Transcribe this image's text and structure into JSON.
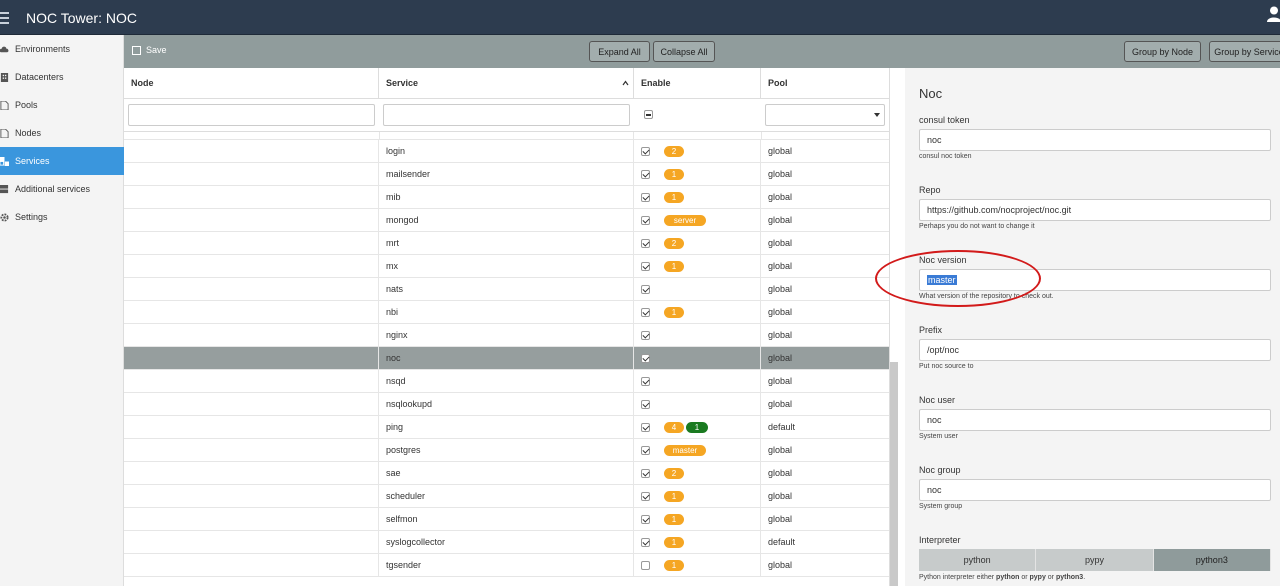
{
  "app": {
    "title": "NOC Tower: NOC"
  },
  "sidebar": {
    "items": [
      {
        "label": "Environments",
        "icon": "cloud-icon"
      },
      {
        "label": "Datacenters",
        "icon": "building-icon"
      },
      {
        "label": "Pools",
        "icon": "document-icon"
      },
      {
        "label": "Nodes",
        "icon": "document-icon"
      },
      {
        "label": "Services",
        "icon": "cubes-icon",
        "active": true
      },
      {
        "label": "Additional services",
        "icon": "server-icon"
      },
      {
        "label": "Settings",
        "icon": "gear-icon"
      }
    ]
  },
  "toolbar": {
    "save": "Save",
    "expand_all": "Expand All",
    "collapse_all": "Collapse All",
    "group_by_node": "Group by Node",
    "group_by_service": "Group by Service"
  },
  "grid": {
    "headers": {
      "node": "Node",
      "service": "Service",
      "enable": "Enable",
      "pool": "Pool"
    },
    "rows": [
      {
        "service": "login",
        "enabled": true,
        "badges": [
          "2"
        ],
        "pool": "global"
      },
      {
        "service": "mailsender",
        "enabled": true,
        "badges": [
          "1"
        ],
        "pool": "global"
      },
      {
        "service": "mib",
        "enabled": true,
        "badges": [
          "1"
        ],
        "pool": "global"
      },
      {
        "service": "mongod",
        "enabled": true,
        "badges": [
          "server"
        ],
        "pool": "global"
      },
      {
        "service": "mrt",
        "enabled": true,
        "badges": [
          "2"
        ],
        "pool": "global"
      },
      {
        "service": "mx",
        "enabled": true,
        "badges": [
          "1"
        ],
        "pool": "global"
      },
      {
        "service": "nats",
        "enabled": true,
        "badges": [],
        "pool": "global"
      },
      {
        "service": "nbi",
        "enabled": true,
        "badges": [
          "1"
        ],
        "pool": "global"
      },
      {
        "service": "nginx",
        "enabled": true,
        "badges": [],
        "pool": "global"
      },
      {
        "service": "noc",
        "enabled": true,
        "badges": [],
        "pool": "global",
        "selected": true
      },
      {
        "service": "nsqd",
        "enabled": true,
        "badges": [],
        "pool": "global"
      },
      {
        "service": "nsqlookupd",
        "enabled": true,
        "badges": [],
        "pool": "global"
      },
      {
        "service": "ping",
        "enabled": true,
        "badges": [
          "4"
        ],
        "green_badge": "1",
        "pool": "default"
      },
      {
        "service": "postgres",
        "enabled": true,
        "badges": [
          "master"
        ],
        "pool": "global"
      },
      {
        "service": "sae",
        "enabled": true,
        "badges": [
          "2"
        ],
        "pool": "global"
      },
      {
        "service": "scheduler",
        "enabled": true,
        "badges": [
          "1"
        ],
        "pool": "global"
      },
      {
        "service": "selfmon",
        "enabled": true,
        "badges": [
          "1"
        ],
        "pool": "global"
      },
      {
        "service": "syslogcollector",
        "enabled": true,
        "badges": [
          "1"
        ],
        "pool": "default"
      },
      {
        "service": "tgsender",
        "enabled": false,
        "badges": [
          "1"
        ],
        "pool": "global"
      }
    ]
  },
  "panel": {
    "title": "Noc",
    "fields": [
      {
        "label": "consul token",
        "value": "noc",
        "help": "consul noc token"
      },
      {
        "label": "Repo",
        "value": "https://github.com/nocproject/noc.git",
        "help": "Perhaps you do not want to change it"
      },
      {
        "label": "Noc version",
        "value": "master",
        "help": "What version of the repository to check out."
      },
      {
        "label": "Prefix",
        "value": "/opt/noc",
        "help": "Put noc source to"
      },
      {
        "label": "Noc user",
        "value": "noc",
        "help": "System user"
      },
      {
        "label": "Noc group",
        "value": "noc",
        "help": "System group"
      }
    ],
    "interpreter": {
      "label": "Interpreter",
      "options": [
        "python",
        "pypy",
        "python3"
      ],
      "selected": "python3",
      "help_prefix": "Python interpreter either ",
      "help_a": "python",
      "help_or1": " or ",
      "help_b": "pypy",
      "help_or2": " or ",
      "help_c": "python3",
      "help_end": "."
    }
  }
}
